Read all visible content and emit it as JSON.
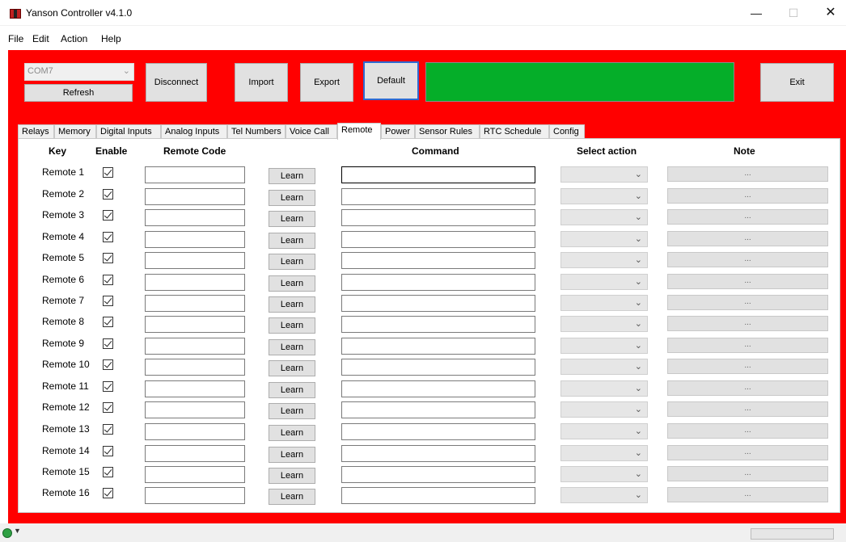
{
  "window": {
    "title": "Yanson Controller v4.1.0",
    "minimize": "—",
    "maximize": "☐",
    "close": "✕"
  },
  "menu": {
    "items": [
      "File",
      "Edit",
      "Action",
      "Help"
    ]
  },
  "toolbar": {
    "port_value": "COM7",
    "refresh_label": "Refresh",
    "disconnect_label": "Disconnect",
    "import_label": "Import",
    "export_label": "Export",
    "default_label": "Default",
    "exit_label": "Exit",
    "status_color": "#05ae29",
    "panel_color": "#ff0000"
  },
  "tabs": [
    {
      "label": "Relays"
    },
    {
      "label": "Memory"
    },
    {
      "label": "Digital Inputs"
    },
    {
      "label": "Analog Inputs"
    },
    {
      "label": "Tel Numbers"
    },
    {
      "label": "Voice Call"
    },
    {
      "label": "Remote",
      "active": true
    },
    {
      "label": "Power"
    },
    {
      "label": "Sensor Rules"
    },
    {
      "label": "RTC Schedule"
    },
    {
      "label": "Config"
    }
  ],
  "table": {
    "headers": {
      "key": "Key",
      "enable": "Enable",
      "remote_code": "Remote Code",
      "command": "Command",
      "select_action": "Select action",
      "note": "Note"
    },
    "learn_label": "Learn",
    "note_placeholder": "...",
    "rows": [
      {
        "key": "Remote 1",
        "enabled": true
      },
      {
        "key": "Remote 2",
        "enabled": true
      },
      {
        "key": "Remote 3",
        "enabled": true
      },
      {
        "key": "Remote 4",
        "enabled": true
      },
      {
        "key": "Remote 5",
        "enabled": true
      },
      {
        "key": "Remote 6",
        "enabled": true
      },
      {
        "key": "Remote 7",
        "enabled": true
      },
      {
        "key": "Remote 8",
        "enabled": true
      },
      {
        "key": "Remote 9",
        "enabled": true
      },
      {
        "key": "Remote 10",
        "enabled": true
      },
      {
        "key": "Remote 11",
        "enabled": true
      },
      {
        "key": "Remote 12",
        "enabled": true
      },
      {
        "key": "Remote 13",
        "enabled": true
      },
      {
        "key": "Remote 14",
        "enabled": true
      },
      {
        "key": "Remote 15",
        "enabled": true
      },
      {
        "key": "Remote 16",
        "enabled": true
      }
    ]
  }
}
